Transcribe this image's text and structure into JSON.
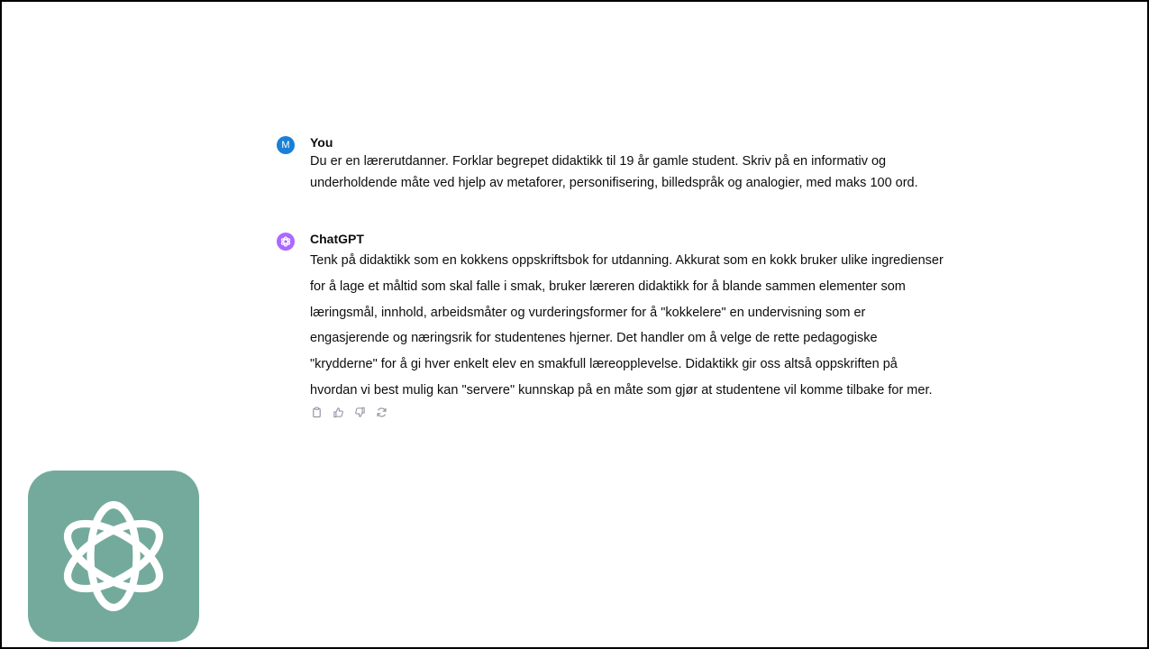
{
  "conversation": {
    "user": {
      "avatar_letter": "M",
      "author": "You",
      "text": "Du er en lærerutdanner. Forklar begrepet didaktikk til 19 år gamle student. Skriv på en informativ og underholdende måte ved hjelp av metaforer, personifisering, billedspråk og analogier, med maks 100 ord."
    },
    "assistant": {
      "author": "ChatGPT",
      "text": "Tenk på didaktikk som en kokkens oppskriftsbok for utdanning. Akkurat som en kokk bruker ulike ingredienser for å lage et måltid som skal falle i smak, bruker læreren didaktikk for å blande sammen elementer som læringsmål, innhold, arbeidsmåter og vurderingsformer for å \"kokkelere\" en undervisning som er engasjerende og næringsrik for studentenes hjerner. Det handler om å velge de rette pedagogiske \"krydderne\" for å gi hver enkelt elev en smakfull læreopplevelse. Didaktikk gir oss altså oppskriften på hvordan vi best mulig kan \"servere\" kunnskap på en måte som gjør at studentene vil komme tilbake for mer."
    },
    "action_icons": [
      "copy-icon",
      "thumbs-up-icon",
      "thumbs-down-icon",
      "regenerate-icon"
    ]
  },
  "colors": {
    "user_avatar": "#1a7fd6",
    "assistant_avatar": "#ab68ff",
    "logo_background": "#74aa9c"
  },
  "logo": {
    "icon": "openai-logo-icon"
  }
}
